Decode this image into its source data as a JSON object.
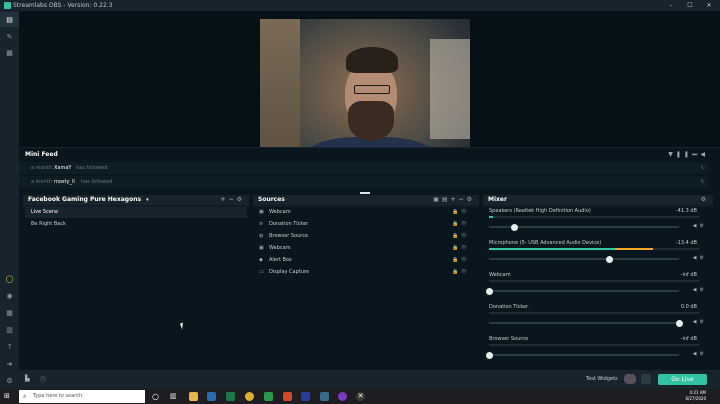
{
  "window": {
    "title": "Streamlabs OBS - Version: 0.22.3",
    "controls": [
      "–",
      "☐",
      "✕"
    ]
  },
  "leftnav": {
    "top_icons": [
      "editor-icon",
      "themes-icon",
      "library-icon"
    ],
    "bottom_icons": [
      "record-dot-icon",
      "settings-icon",
      "layout-icon",
      "studio-icon",
      "help-icon",
      "logout-icon",
      "gear-icon"
    ]
  },
  "minifeed": {
    "title": "Mini Feed",
    "items": [
      {
        "ago": "a month",
        "name": "XamaY",
        "action": "has followed"
      },
      {
        "ago": "a month",
        "name": "mosty_ll",
        "action": "has followed"
      }
    ]
  },
  "scenes": {
    "header": "Facebook Gaming Pure Hexagons",
    "items": [
      {
        "label": "Live Scene",
        "active": true
      },
      {
        "label": "Be Right Back",
        "active": false
      }
    ]
  },
  "sources": {
    "header": "Sources",
    "items": [
      {
        "label": "Webcam",
        "icon": "camera-icon"
      },
      {
        "label": "Donation Ticker",
        "icon": "text-icon"
      },
      {
        "label": "Browser Source",
        "icon": "globe-icon"
      },
      {
        "label": "Webcam",
        "icon": "camera-icon"
      },
      {
        "label": "Alert Box",
        "icon": "bell-icon"
      },
      {
        "label": "Display Capture",
        "icon": "monitor-icon"
      }
    ]
  },
  "mixer": {
    "header": "Mixer",
    "items": [
      {
        "name": "Speakers (Realtek High Definition Audio)",
        "db": "-41.3 dB",
        "level": 0.02,
        "volume": 0.13
      },
      {
        "name": "Microphone (5- USB Advanced Audio Device)",
        "db": "-13.4 dB",
        "level": 0.78,
        "volume": 0.63
      },
      {
        "name": "Webcam",
        "db": "-inf dB",
        "level": 0,
        "volume": 0
      },
      {
        "name": "Donation Ticker",
        "db": "0.0 dB",
        "level": 0,
        "volume": 1.0
      },
      {
        "name": "Browser Source",
        "db": "-inf dB",
        "level": 0,
        "volume": 0
      }
    ]
  },
  "bottombar": {
    "test_widgets": "Test Widgets",
    "go_live": "Go Live"
  },
  "taskbar": {
    "search_placeholder": "Type here to search",
    "time": "4:21 AM",
    "date": "6/27/2020"
  },
  "colors": {
    "accent": "#31c3a2",
    "background": "#09161d",
    "panel": "#17242d",
    "mic_peak": "#f5a623"
  }
}
